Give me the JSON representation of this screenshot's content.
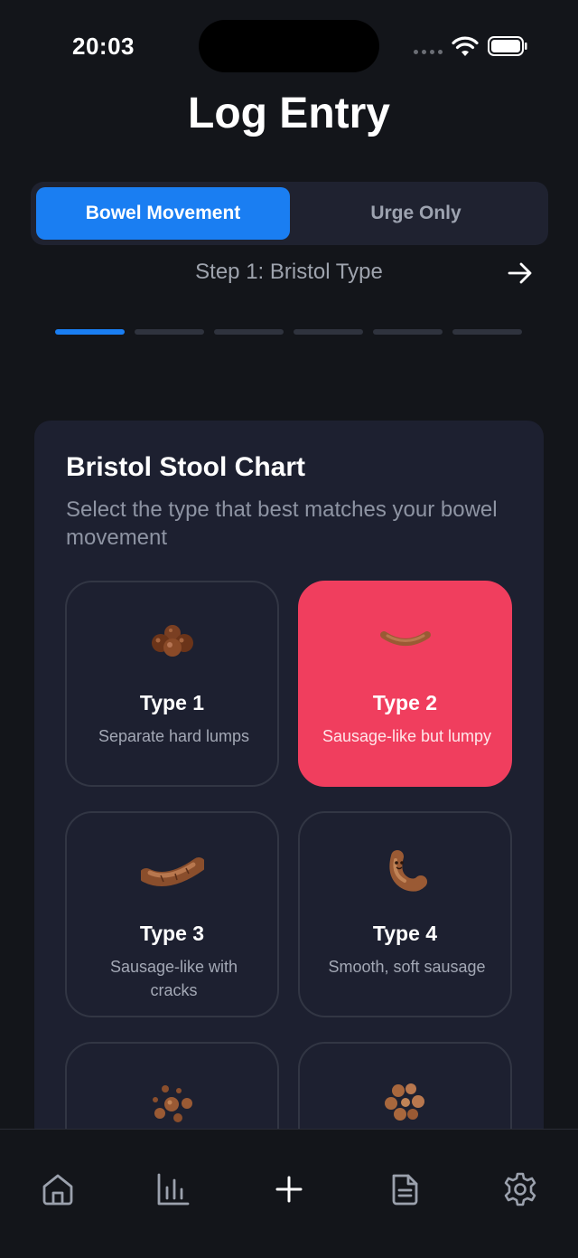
{
  "status": {
    "time": "20:03"
  },
  "header": {
    "title": "Log Entry"
  },
  "segment": {
    "active": "Bowel Movement",
    "inactive": "Urge Only"
  },
  "step": {
    "label": "Step 1: Bristol Type",
    "current": 1,
    "total": 6
  },
  "chart": {
    "title": "Bristol Stool Chart",
    "subtitle": "Select the type that best matches your bowel movement",
    "types": [
      {
        "name": "Type 1",
        "desc": "Separate hard lumps",
        "selected": false
      },
      {
        "name": "Type 2",
        "desc": "Sausage-like but lumpy",
        "selected": true
      },
      {
        "name": "Type 3",
        "desc": "Sausage-like with cracks",
        "selected": false
      },
      {
        "name": "Type 4",
        "desc": "Smooth, soft sausage",
        "selected": false
      }
    ]
  },
  "tabs": [
    "home-icon",
    "chart-icon",
    "add-icon",
    "document-icon",
    "settings-icon"
  ],
  "colors": {
    "accent": "#1a7ef2",
    "selected": "#f03e5e",
    "background": "#13151a",
    "card": "#1d2030"
  }
}
